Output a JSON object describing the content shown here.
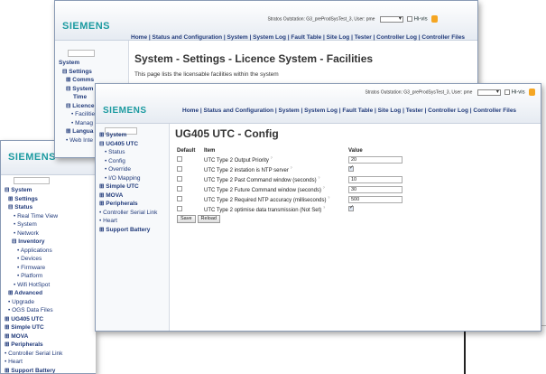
{
  "brand": "SIEMENS",
  "nav_links": "Home | Status and Configuration | System | System Log | Fault Table | Site Log | Tester | Controller Log | Controller Files",
  "status_text": "Stratos Outstation: G3_preProdSysTest_3, User: pme",
  "hivis_label": "Hi-vis",
  "back_window": {
    "title": "System - Settings - Licence System - Facilities",
    "description": "This page lists the licensable facilities within the system",
    "tree": [
      "System",
      "Settings",
      "Comms",
      "System Date &",
      "Time",
      "Licence",
      "Facilities",
      "Manag",
      "Langua",
      "Web Inte"
    ]
  },
  "front_window": {
    "title": "UG405 UTC - Config",
    "tree": {
      "system": "System",
      "ug405": "UG405 UTC",
      "status": "Status",
      "config": "Config",
      "override": "Override",
      "io_mapping": "I/O Mapping",
      "simple_utc": "Simple UTC",
      "mova": "MOVA",
      "peripherals": "Peripherals",
      "controller_serial_link": "Controller Serial Link",
      "heart": "Heart",
      "support_battery": "Support Battery"
    },
    "table": {
      "headers": {
        "default": "Default",
        "item": "Item",
        "value": "Value"
      },
      "rows": [
        {
          "item": "UTC Type 2 Output Priority",
          "value": "20",
          "type": "text"
        },
        {
          "item": "UTC Type 2 instation is NTP server",
          "value": "",
          "type": "check"
        },
        {
          "item": "UTC Type 2 Past Command window (seconds)",
          "value": "10",
          "type": "text"
        },
        {
          "item": "UTC Type 2 Future Command window (seconds)",
          "value": "30",
          "type": "text"
        },
        {
          "item": "UTC Type 2 Required NTP accuracy (milliseconds)",
          "value": "500",
          "type": "text"
        },
        {
          "item": "UTC Type 2 optimise data transmission (Not Set)",
          "value": "",
          "type": "check"
        }
      ]
    },
    "save_label": "Save",
    "reload_label": "Reload"
  },
  "left_window": {
    "tree": {
      "system": "System",
      "settings": "Settings",
      "status": "Status",
      "real_time_view": "Real Time View",
      "system_item": "System",
      "network": "Network",
      "inventory": "Inventory",
      "applications": "Applications",
      "devices": "Devices",
      "firmware": "Firmware",
      "platform": "Platform",
      "wifi_hotspot": "Wifi HotSpot",
      "advanced": "Advanced",
      "upgrade": "Upgrade",
      "ogs_data_files": "OGS Data Files",
      "ug405_utc": "UG405 UTC",
      "simple_utc": "Simple UTC",
      "mova": "MOVA",
      "peripherals": "Peripherals",
      "controller_serial_link": "Controller Serial Link",
      "heart": "Heart",
      "support_battery": "Support Battery"
    }
  }
}
